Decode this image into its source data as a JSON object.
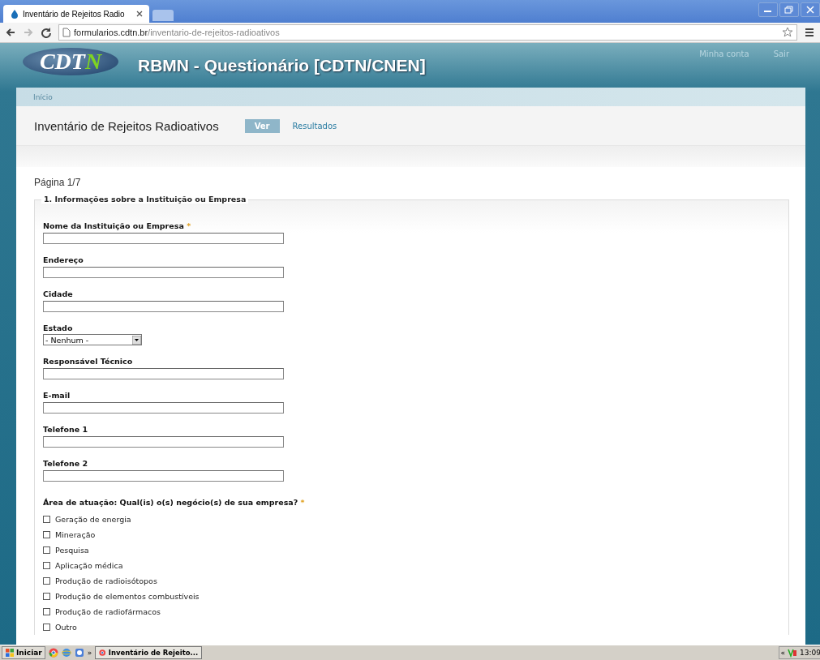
{
  "browser": {
    "tab_title": "Inventário de Rejeitos Radio",
    "url_host": "formularios.cdtn.br",
    "url_path": "/inventario-de-rejeitos-radioativos"
  },
  "header": {
    "logo": "CDT",
    "logo_accent": "N",
    "site_title": "RBMN - Questionário [CDTN/CNEN]",
    "user_links": [
      "Minha conta",
      "Sair"
    ]
  },
  "breadcrumb": "Início",
  "page": {
    "title": "Inventário de Rejeitos Radioativos",
    "tabs": [
      {
        "label": "Ver",
        "selected": true
      },
      {
        "label": "Resultados",
        "selected": false
      }
    ]
  },
  "pager": "Página 1/7",
  "fieldset": {
    "legend": "1. Informações sobre a Instituição ou Empresa",
    "fields": [
      {
        "kind": "text",
        "label": "Nome da Instituição ou Empresa",
        "required_mark": "*"
      },
      {
        "kind": "text",
        "label": "Endereço"
      },
      {
        "kind": "text",
        "label": "Cidade"
      },
      {
        "kind": "select",
        "label": "Estado",
        "value": "- Nenhum -"
      },
      {
        "kind": "text",
        "label": "Responsável Técnico"
      },
      {
        "kind": "text",
        "label": "E-mail"
      },
      {
        "kind": "text",
        "label": "Telefone 1"
      },
      {
        "kind": "text",
        "label": "Telefone 2"
      }
    ],
    "question": {
      "label": "Área de atuação: Qual(is) o(s) negócio(s) de sua empresa?",
      "required_mark": "*",
      "options": [
        {
          "label": "Geração de energia",
          "checked": false
        },
        {
          "label": "Mineração",
          "checked": false
        },
        {
          "label": "Pesquisa",
          "checked": false
        },
        {
          "label": "Aplicação médica",
          "checked": false
        },
        {
          "label": "Produção de radioisótopos",
          "checked": false
        },
        {
          "label": "Produção de elementos combustíveis",
          "checked": false
        },
        {
          "label": "Produção de radiofármacos",
          "checked": false
        },
        {
          "label": "Outro",
          "checked": false
        }
      ]
    }
  },
  "taskbar": {
    "start": "Iniciar",
    "more": "»",
    "task": "Inventário de Rejeito...",
    "tray_toggle": "«",
    "clock": "13:09"
  }
}
